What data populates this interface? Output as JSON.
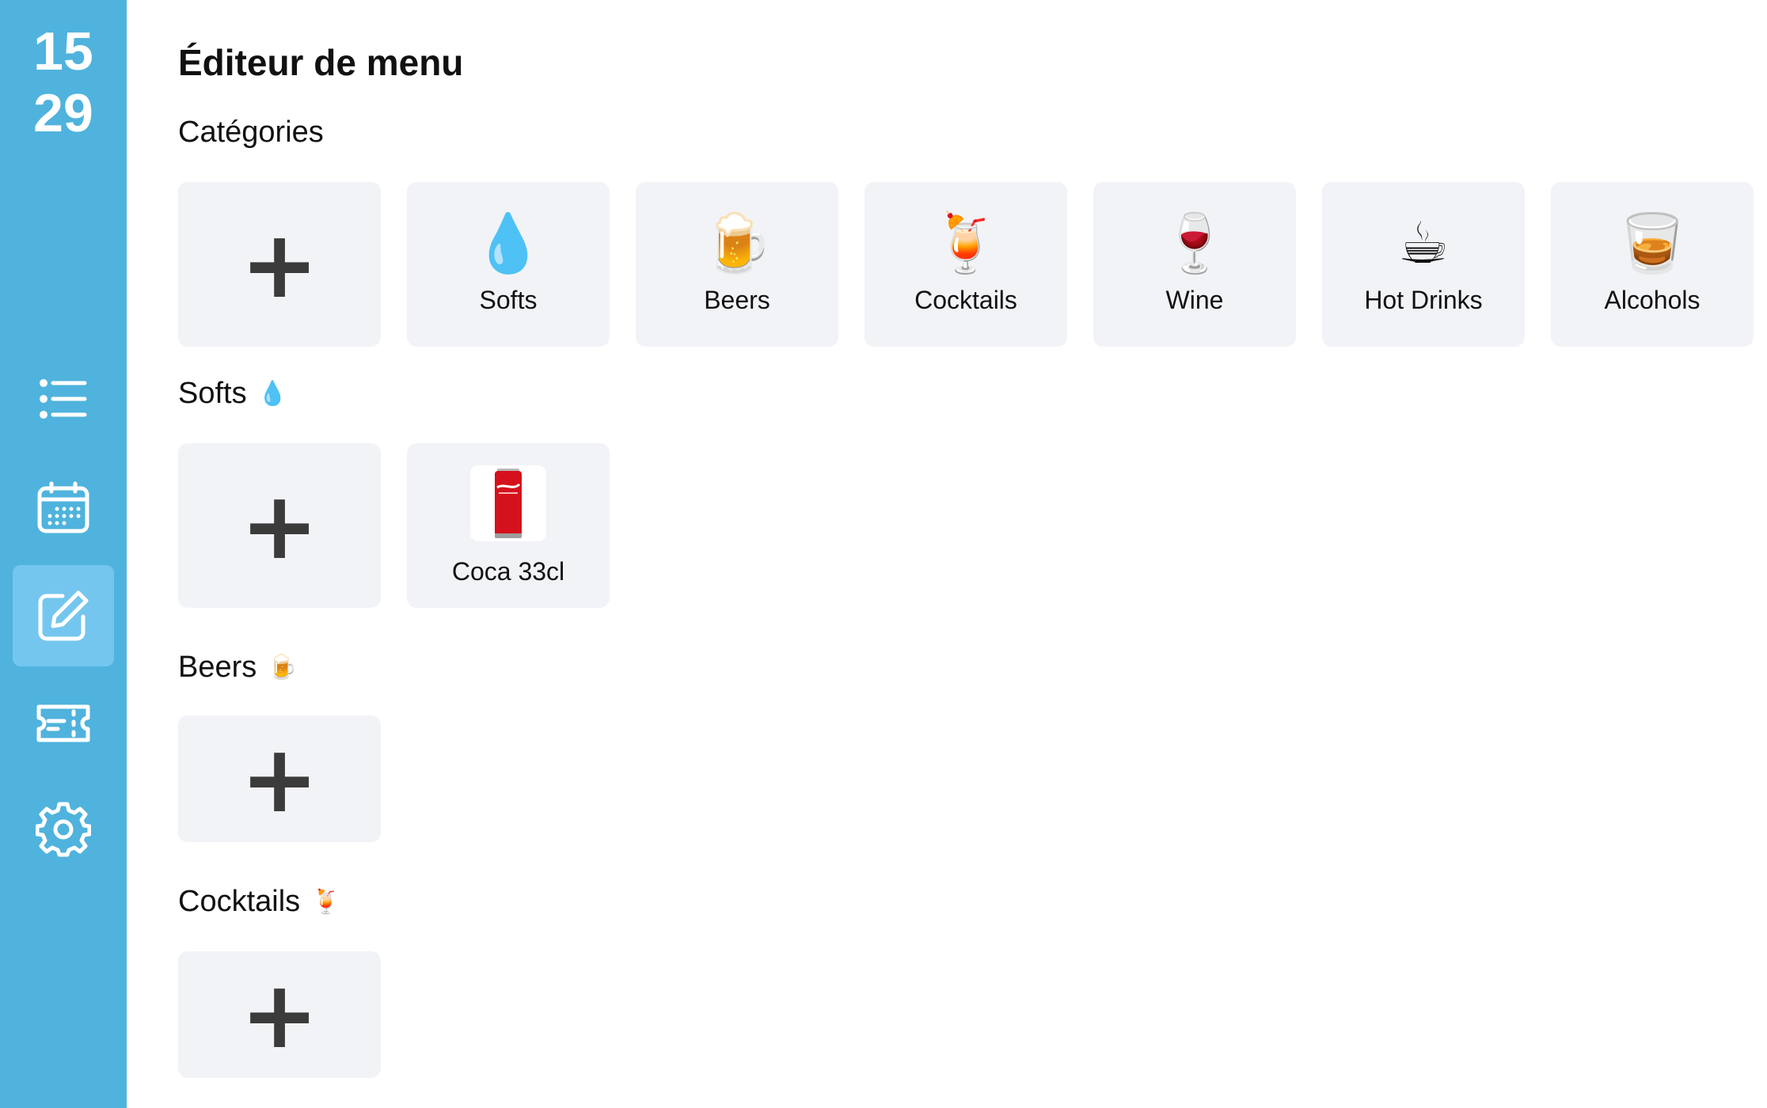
{
  "sidebar": {
    "clock": {
      "hours": "15",
      "minutes": "29"
    },
    "nav": [
      {
        "name": "list-icon"
      },
      {
        "name": "calendar-icon"
      },
      {
        "name": "edit-icon",
        "active": true
      },
      {
        "name": "ticket-icon"
      },
      {
        "name": "gear-icon"
      }
    ],
    "colors": {
      "background": "#4fb3dd",
      "active": "#74c6ef"
    }
  },
  "main": {
    "title": "Éditeur de menu",
    "categories": {
      "title": "Catégories",
      "add_symbol": "+",
      "items": [
        {
          "label": "Softs",
          "emoji": "💧"
        },
        {
          "label": "Beers",
          "emoji": "🍺"
        },
        {
          "label": "Cocktails",
          "emoji": "🍹"
        },
        {
          "label": "Wine",
          "emoji": "🍷"
        },
        {
          "label": "Hot Drinks",
          "emoji": "☕"
        },
        {
          "label": "Alcohols",
          "emoji": "🥃"
        }
      ]
    },
    "sections": [
      {
        "title": "Softs",
        "emoji": "💧",
        "add_symbol": "+",
        "products": [
          {
            "label": "Coca 33cl",
            "image": "coca-cola-can"
          }
        ]
      },
      {
        "title": "Beers",
        "emoji": "🍺",
        "add_symbol": "+",
        "products": []
      },
      {
        "title": "Cocktails",
        "emoji": "🍹",
        "add_symbol": "+",
        "products": []
      }
    ]
  }
}
